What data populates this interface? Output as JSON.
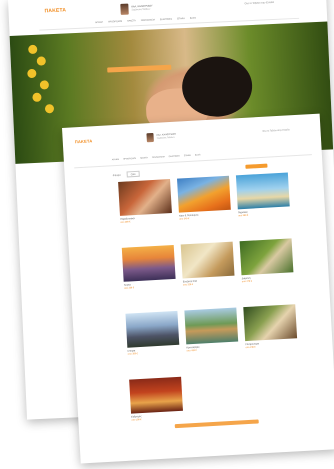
{
  "colors": {
    "accent": "#f18a1c",
    "button": "#f5a54a"
  },
  "back_page": {
    "logo": "ΠΑΚΕΤΑ",
    "profile_name": "ΚΑΛ. ΚΑΛΟΓΡΙΔΟΥ",
    "profile_sub": "Συμβουλος Ταξιδιων",
    "contact": "Ολα τα Ταξιδια στην Ελλαδα",
    "nav": [
      "ΑΡΧΙΚΗ",
      "ΠΡΟΟΡΙΣΜΟΙ",
      "ΠΑΚΕΤΑ",
      "ΞΕΝΟΔΟΧΕΙΑ",
      "ΕΚΔΡΟΜΕΣ",
      "ΕΠΑΦΗ",
      "BLOG"
    ],
    "hero_image": "spa-woman-with-flower"
  },
  "front_page": {
    "logo": "ΠΑΚΕΤΑ",
    "profile_name": "ΚΑΛ. ΚΑΛΟΓΡΙΔΟΥ",
    "profile_sub": "Συμβουλος Ταξιδιων",
    "contact": "Ολα τα Ταξιδια στην Ελλαδα",
    "nav": [
      "ΑΡΧΙΚΗ",
      "ΠΡΟΟΡΙΣΜΟΙ",
      "ΠΑΚΕΤΑ",
      "ΞΕΝΟΔΟΧΕΙΑ",
      "ΕΚΔΡΟΜΕΣ",
      "ΕΠΑΦΗ",
      "BLOG"
    ],
    "filter_label": "Φιλτρα",
    "filter_value": "Ολα",
    "cards": [
      {
        "title": "Παραδοσιακα",
        "price": "απο 299 €",
        "image": "market-people"
      },
      {
        "title": "Ναοι & Πολιτισμος",
        "price": "απο 349 €",
        "image": "temple-orange"
      },
      {
        "title": "Παραλιες",
        "price": "απο 399 €",
        "image": "beach"
      },
      {
        "title": "Γιογκα",
        "price": "απο 259 €",
        "image": "yoga-sunset"
      },
      {
        "title": "Ευεξια & Σπα",
        "price": "απο 329 €",
        "image": "spa-room"
      },
      {
        "title": "Διαμονη",
        "price": "απο 279 €",
        "image": "villa-garden"
      },
      {
        "title": "Ιστορια",
        "price": "απο 359 €",
        "image": "ancient-temple"
      },
      {
        "title": "Κρουαζιερες",
        "price": "απο 459 €",
        "image": "river-cruise"
      },
      {
        "title": "Γαστρονομια",
        "price": "απο 239 €",
        "image": "dining"
      },
      {
        "title": "Εκδρομες",
        "price": "απο 199 €",
        "image": "monk-temple"
      }
    ]
  }
}
